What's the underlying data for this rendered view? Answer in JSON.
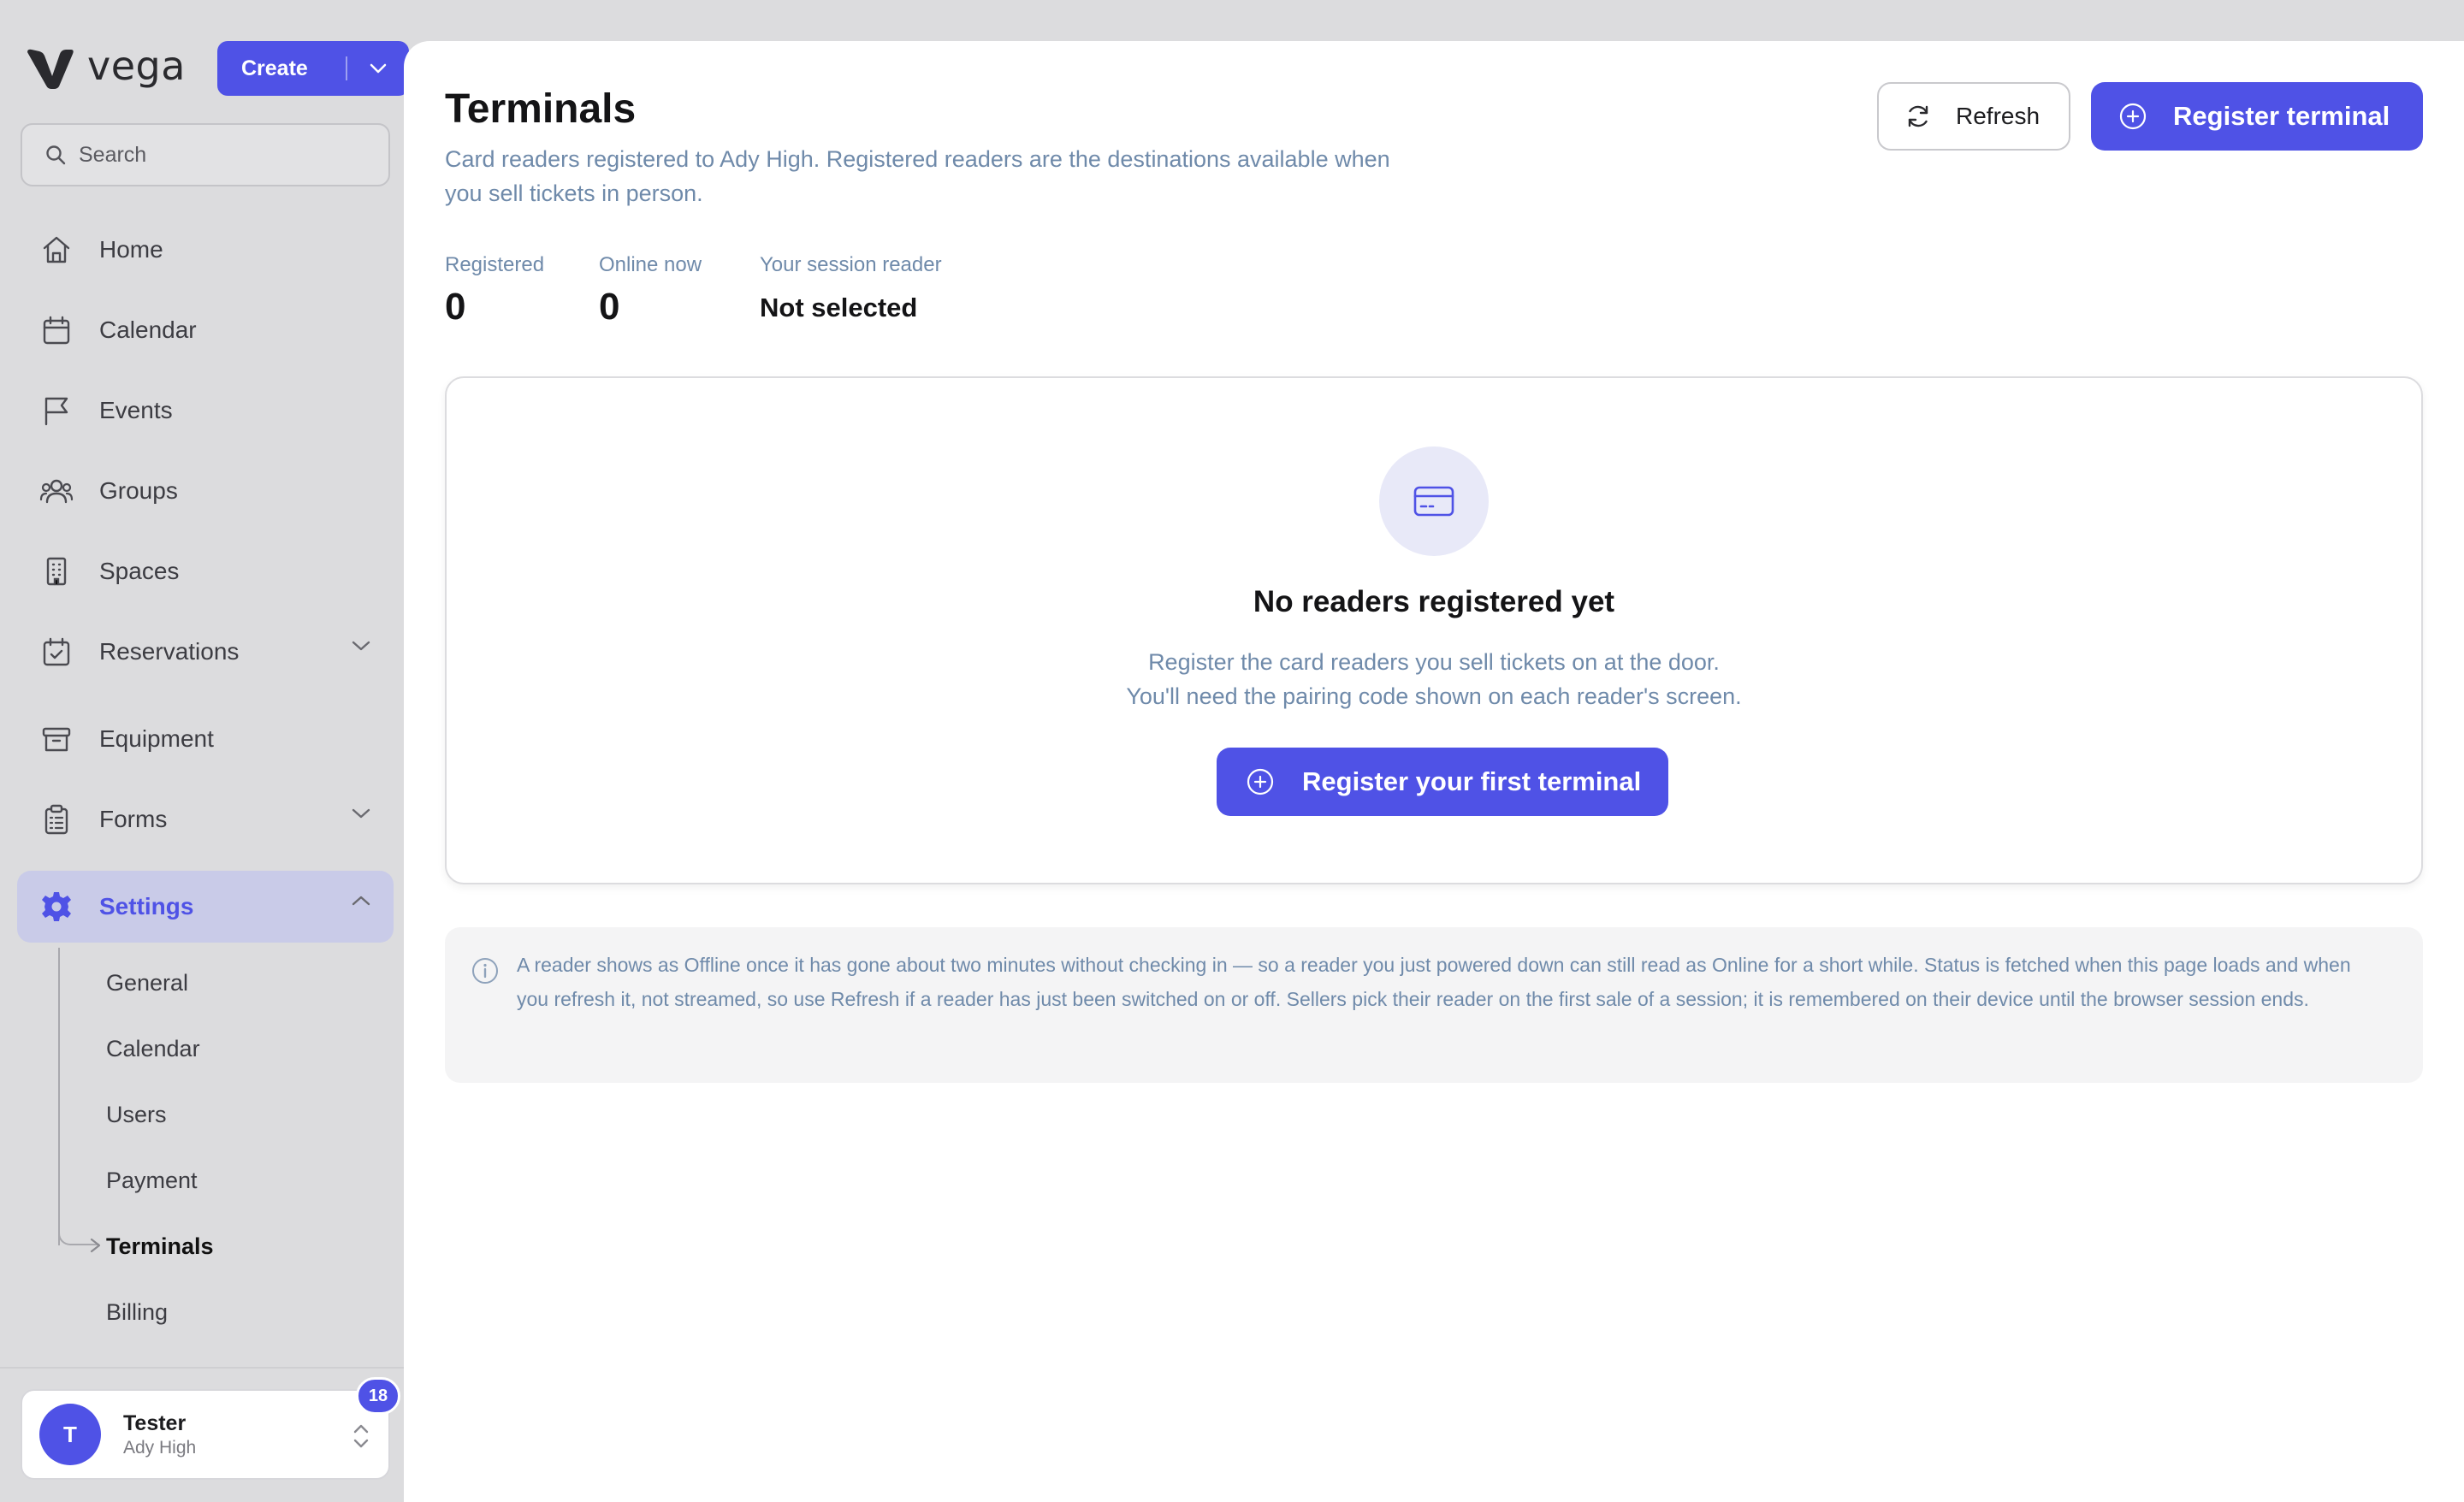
{
  "brand": {
    "name": "vega"
  },
  "create": {
    "label": "Create"
  },
  "search": {
    "placeholder": "Search"
  },
  "nav": {
    "home": "Home",
    "calendar": "Calendar",
    "events": "Events",
    "groups": "Groups",
    "spaces": "Spaces",
    "reservations": "Reservations",
    "equipment": "Equipment",
    "forms": "Forms",
    "settings": "Settings"
  },
  "settings_sub": {
    "general": "General",
    "calendar": "Calendar",
    "users": "Users",
    "payment": "Payment",
    "terminals": "Terminals",
    "billing": "Billing"
  },
  "user": {
    "initial": "T",
    "name": "Tester",
    "org": "Ady High",
    "notifications": "18"
  },
  "page": {
    "title": "Terminals",
    "description": "Card readers registered to Ady High. Registered readers are the destinations available when you sell tickets in person.",
    "refresh_label": "Refresh",
    "register_label": "Register terminal"
  },
  "stats": {
    "registered_label": "Registered",
    "registered_value": "0",
    "online_label": "Online now",
    "online_value": "0",
    "session_label": "Your session reader",
    "session_value": "Not selected"
  },
  "empty": {
    "title": "No readers registered yet",
    "line1": "Register the card readers you sell tickets on at the door.",
    "line2": "You'll need the pairing code shown on each reader's screen.",
    "button_label": "Register your first terminal"
  },
  "info": {
    "text": "A reader shows as Offline once it has gone about two minutes without checking in — so a reader you just powered down can still read as Online for a short while. Status is fetched when this page loads and when you refresh it, not streamed, so use Refresh if a reader has just been switched on or off. Sellers pick their reader on the first sale of a session; it is remembered on their device until the browser session ends."
  },
  "colors": {
    "accent": "#4f52e6",
    "muted_text": "#6f8aaa",
    "sidebar_bg": "#dcdcde",
    "active_nav_bg": "#c9cbe8"
  }
}
